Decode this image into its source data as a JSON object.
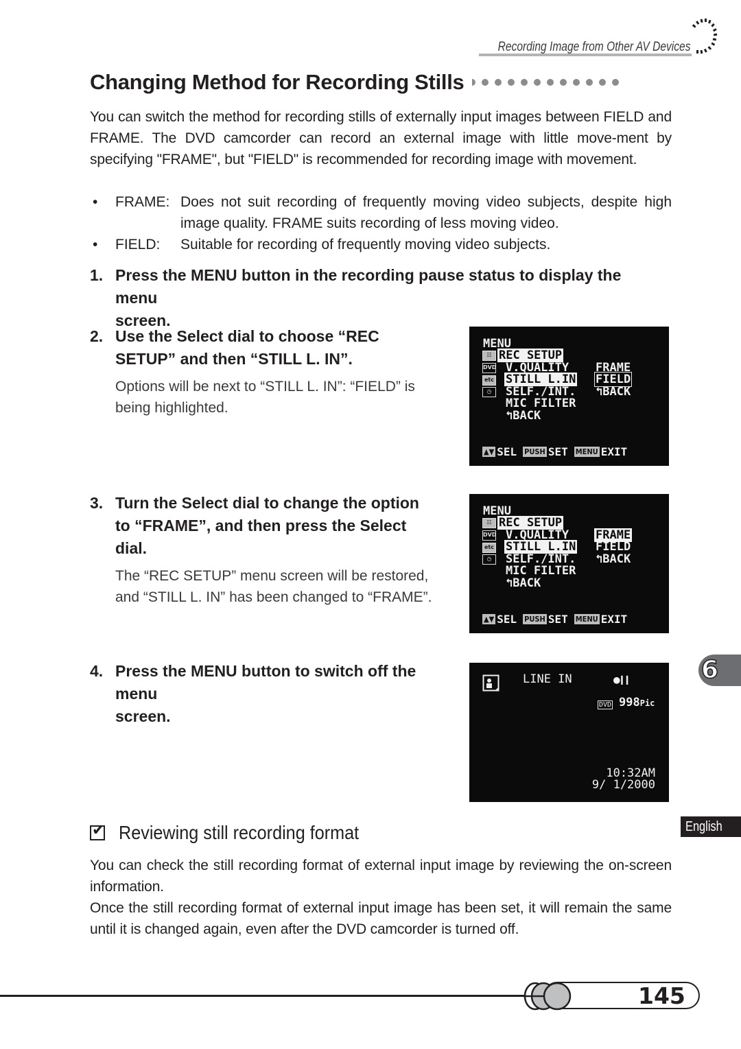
{
  "header": {
    "running_head": "Recording Image from Other AV Devices"
  },
  "title": "Changing Method for Recording Stills",
  "intro": "You can switch the method for recording stills of externally input images between FIELD and FRAME. The DVD camcorder can record an external image with little move-ment by specifying \"FRAME\", but \"FIELD\" is recommended for recording image with movement.",
  "bullets": [
    {
      "label": "FRAME:",
      "desc": "Does not suit recording of frequently moving video subjects, despite high image quality. FRAME suits recording of less moving video."
    },
    {
      "label": "FIELD:",
      "desc": "Suitable for recording of frequently moving video subjects."
    }
  ],
  "steps": [
    {
      "num": "1.",
      "text_line1": "Press the MENU button in the recording pause status to display the",
      "text_line2": "menu screen."
    },
    {
      "num": "2.",
      "text_line1": "Use the Select dial to choose “REC",
      "text_line2": "SETUP” and then “STILL L. IN”.",
      "note_line1": "Options will be next to “STILL L. IN”: “FIELD” is",
      "note_line2": "being highlighted."
    },
    {
      "num": "3.",
      "text_line1": "Turn the Select dial to change the option",
      "text_line2": "to “FRAME”, and then press the Select",
      "text_line3": "dial.",
      "note_line1": "The “REC SETUP” menu screen will be restored,",
      "note_line2": "and “STILL L. IN” has been changed to “FRAME”."
    },
    {
      "num": "4.",
      "text_line1": "Press the MENU button to switch off the",
      "text_line2": "menu screen."
    }
  ],
  "osd_menu_1": {
    "menu": "MENU",
    "rec_setup": "REC SETUP",
    "items": [
      "V.QUALITY",
      "STILL L.IN",
      "SELF./INT.",
      "MIC FILTER",
      "↰BACK"
    ],
    "options": [
      "FRAME",
      "FIELD",
      "↰BACK"
    ],
    "selected_option": "FIELD",
    "icons": [
      "rec-setup-icon",
      "dvd-icon",
      "etc-icon",
      "clock-icon"
    ],
    "icon_labels": [
      "☷",
      "DVD",
      "etc",
      "◷"
    ],
    "footer": {
      "sel_tag": "▲▼",
      "sel": "SEL",
      "push_tag": "PUSH",
      "set": "SET",
      "menu_tag": "MENU",
      "exit": "EXIT"
    }
  },
  "osd_menu_2": {
    "menu": "MENU",
    "rec_setup": "REC SETUP",
    "items": [
      "V.QUALITY",
      "STILL L.IN",
      "SELF./INT.",
      "MIC FILTER",
      "↰BACK"
    ],
    "options": [
      "FRAME",
      "FIELD",
      "↰BACK"
    ],
    "selected_option": "FRAME",
    "icon_labels": [
      "☷",
      "DVD",
      "etc",
      "◷"
    ],
    "footer": {
      "sel_tag": "▲▼",
      "sel": "SEL",
      "push_tag": "PUSH",
      "set": "SET",
      "menu_tag": "MENU",
      "exit": "EXIT"
    }
  },
  "osd_record": {
    "source": "LINE IN",
    "status": "●❙❙",
    "media_tag": "DVD",
    "remaining": "998",
    "remaining_unit": "Pic",
    "time": "10:32AM",
    "date": "9/ 1/2000"
  },
  "side_tabs": {
    "chapter": "6",
    "language": "English"
  },
  "subheading": "Reviewing still recording format",
  "outro_p1": "You can check the still recording format of external input image by reviewing the on-screen information.",
  "outro_p2": "Once the still recording format of external input image has been set, it will remain the same until it is changed again, even after the DVD camcorder is turned off.",
  "page_number": "145"
}
